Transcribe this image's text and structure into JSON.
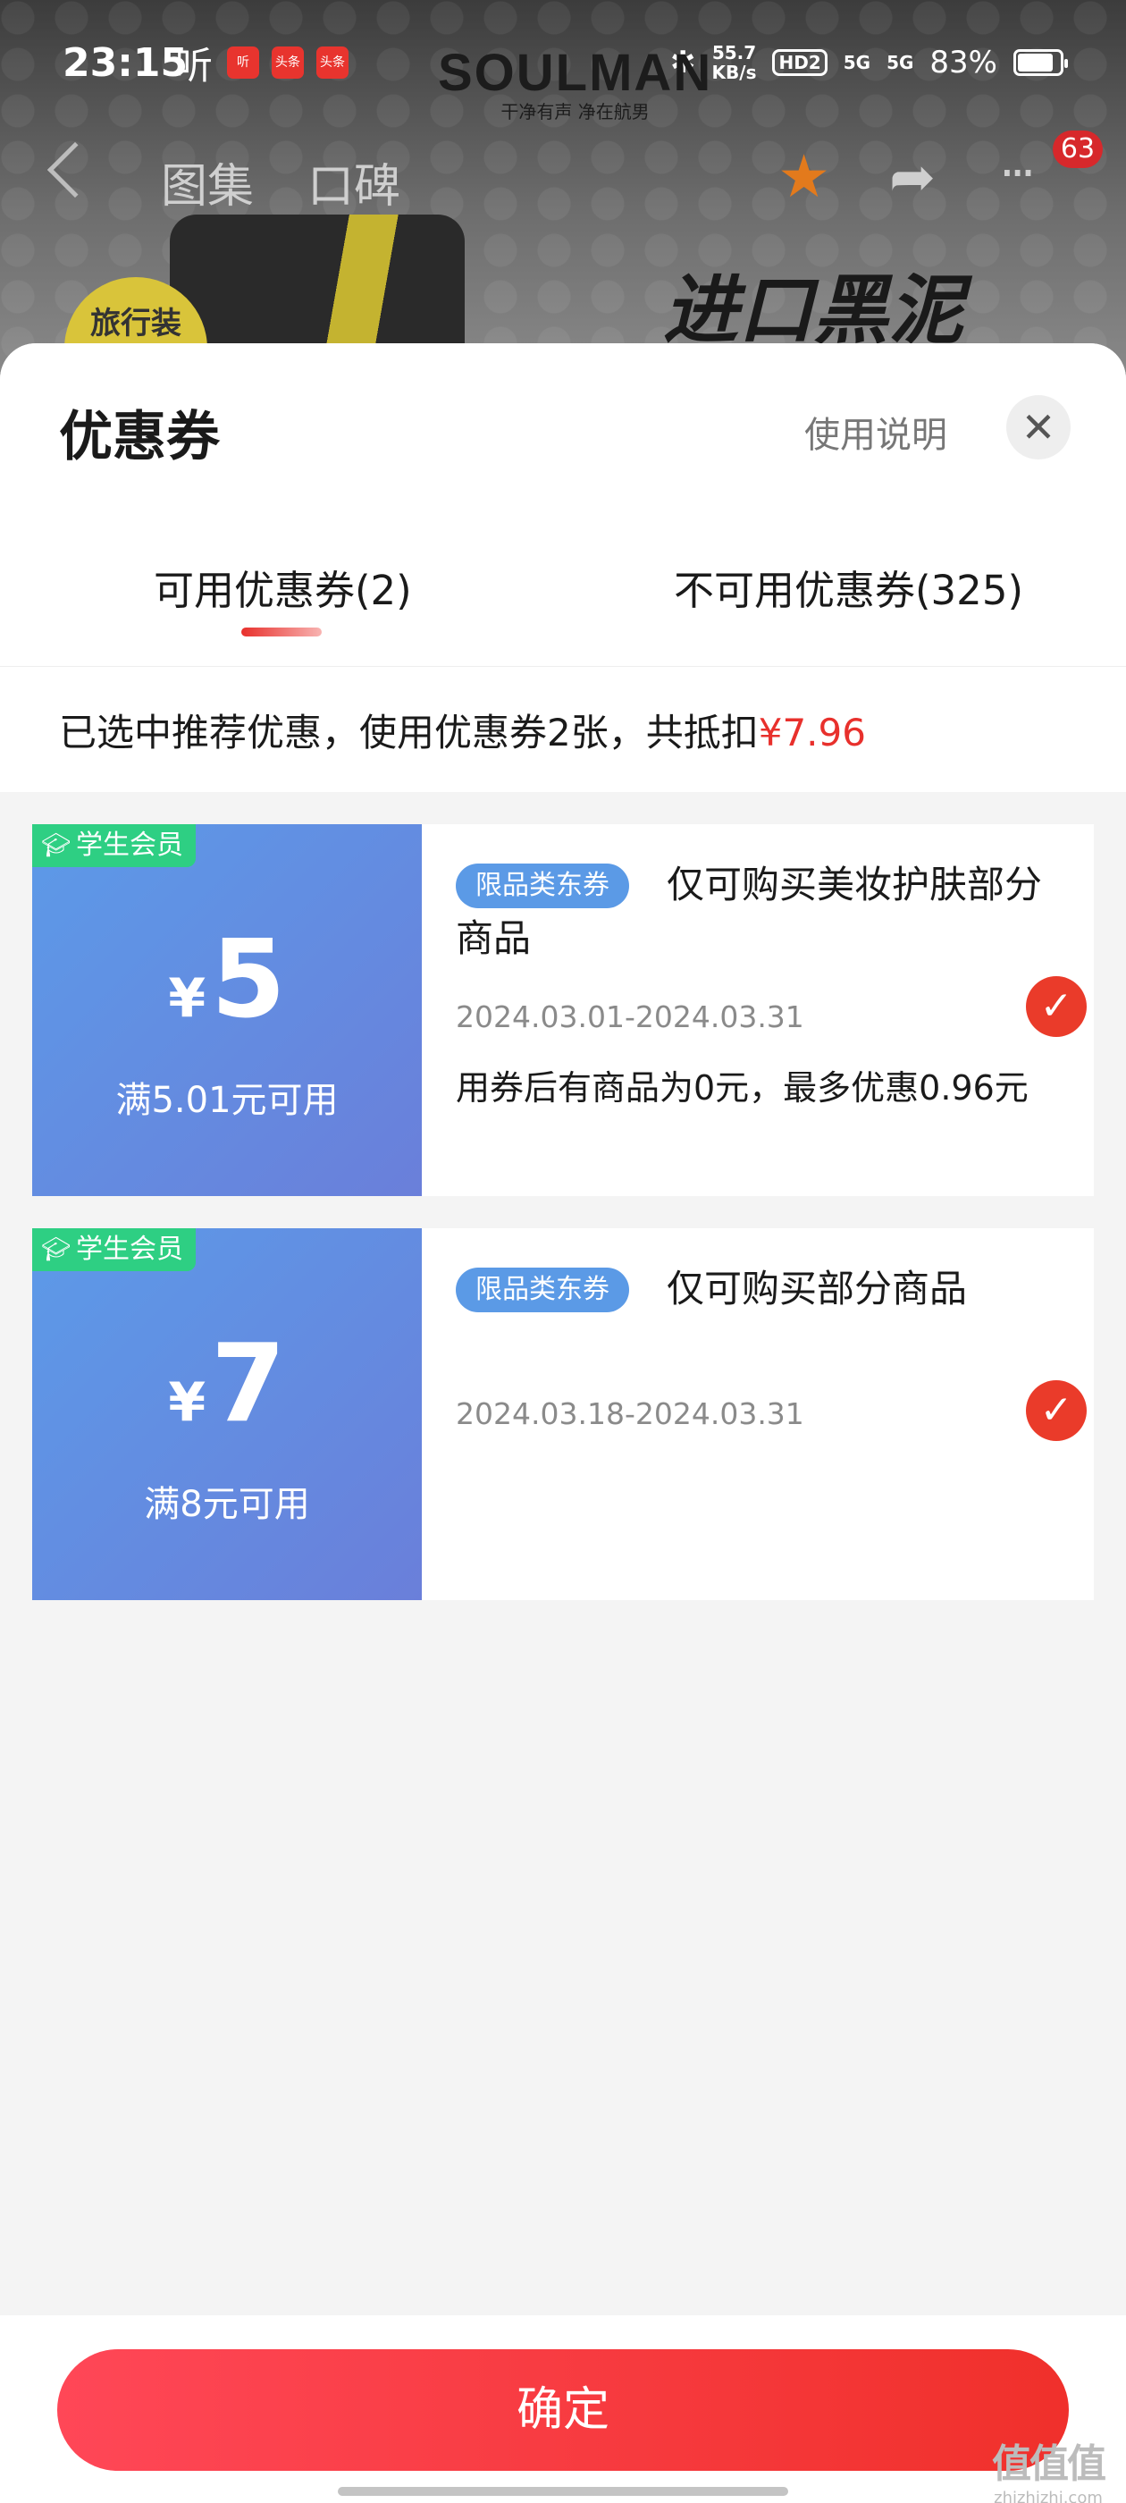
{
  "status_bar": {
    "time": "23:15",
    "ting": "听",
    "app_icons": [
      "听",
      "头条",
      "头条"
    ],
    "bluetooth": "✱",
    "net_speed_value": "55.7",
    "net_speed_unit": "KB/s",
    "hd": "HD2",
    "sig1": "5G",
    "sig2": "5G",
    "battery": "83%"
  },
  "product_header": {
    "brand": "SOULMAN",
    "slogan": "干净有声 净在航男",
    "tab_gallery": "图集",
    "tab_reviews": "口碑",
    "cart_badge": "63",
    "travel_badge": "旅行装",
    "promo_text": "进口黑泥",
    "star_color": "#e37a1c"
  },
  "sheet": {
    "title": "优惠券",
    "help": "使用说明",
    "close_icon": "✕",
    "tabs": [
      {
        "label": "可用优惠券(2)"
      },
      {
        "label": "不可用优惠券(325)"
      }
    ],
    "summary_prefix": "已选中推荐优惠，使用优惠券2张，共抵扣",
    "summary_amount": "¥7.96"
  },
  "coupons": [
    {
      "member_tag": "学生会员",
      "yen": "¥",
      "value": "5",
      "condition": "满5.01元可用",
      "category": "限品类东券",
      "desc": "仅可购买美妆护肤部分商品",
      "date": "2024.03.01-2024.03.31",
      "note": "用券后有商品为0元，最多优惠0.96元",
      "checked": true
    },
    {
      "member_tag": "学生会员",
      "yen": "¥",
      "value": "7",
      "condition": "满8元可用",
      "category": "限品类东券",
      "desc": "仅可购买部分商品",
      "date": "2024.03.18-2024.03.31",
      "note": "",
      "checked": true
    }
  ],
  "confirm_label": "确定",
  "watermark": {
    "logo": "值值值",
    "url": "zhizhizhi.com"
  },
  "colors": {
    "accent": "#e8302c",
    "coupon_blue": "#5c9ae8",
    "member_green": "#2ecf83"
  }
}
